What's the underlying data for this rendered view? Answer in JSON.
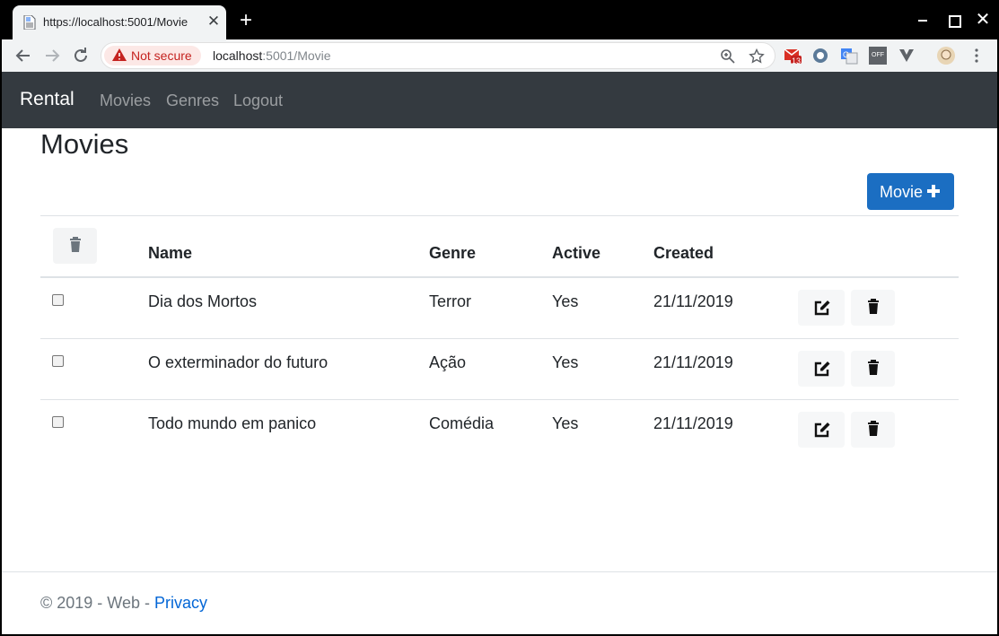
{
  "browser": {
    "tab_title": "https://localhost:5001/Movie",
    "close_glyph": "✕",
    "new_tab_glyph": "+",
    "security_label": "Not secure",
    "url_host": "localhost",
    "url_rest": ":5001/Movie",
    "extension_badge": "13",
    "off_badge": "OFF"
  },
  "navbar": {
    "brand": "Rental",
    "links": [
      "Movies",
      "Genres",
      "Logout"
    ]
  },
  "page": {
    "title": "Movies",
    "add_button_label": "Movie"
  },
  "table": {
    "headers": {
      "name": "Name",
      "genre": "Genre",
      "active": "Active",
      "created": "Created"
    },
    "rows": [
      {
        "name": "Dia dos Mortos",
        "genre": "Terror",
        "active": "Yes",
        "created": "21/11/2019"
      },
      {
        "name": "O exterminador do futuro",
        "genre": "Ação",
        "active": "Yes",
        "created": "21/11/2019"
      },
      {
        "name": "Todo mundo em panico",
        "genre": "Comédia",
        "active": "Yes",
        "created": "21/11/2019"
      }
    ]
  },
  "footer": {
    "text": "© 2019 - Web - ",
    "privacy_link": "Privacy"
  },
  "colors": {
    "navbar_bg": "#343a40",
    "primary": "#1b6ec2",
    "link": "#0366d6"
  }
}
